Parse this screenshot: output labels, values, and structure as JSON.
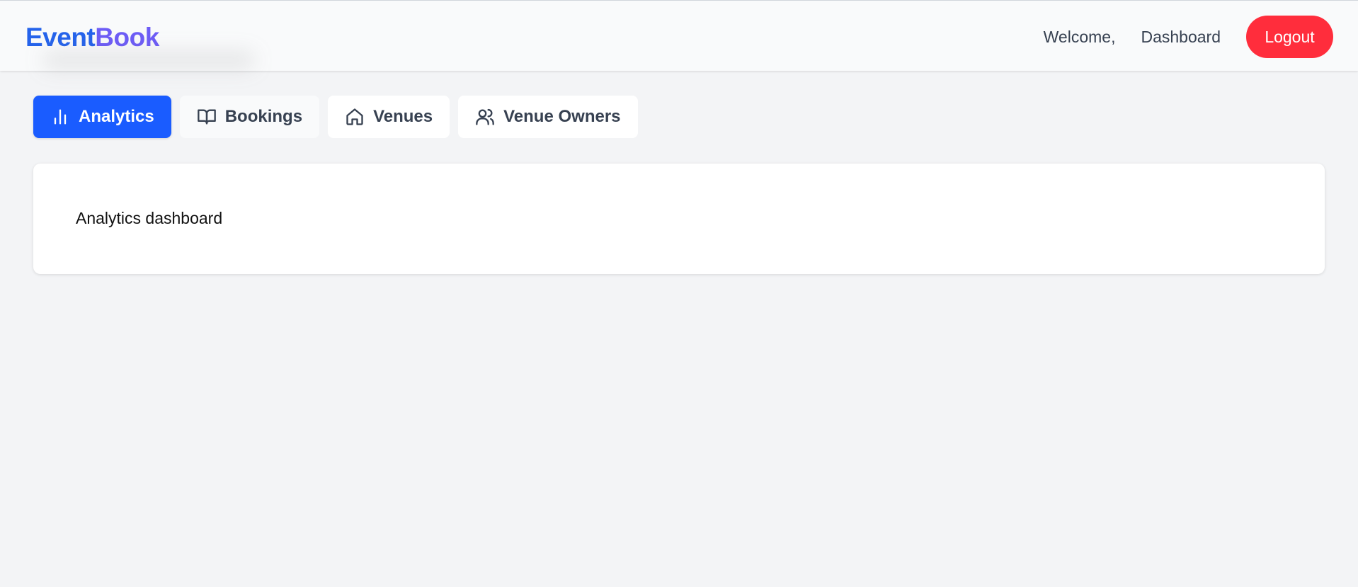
{
  "header": {
    "brand_part1": "Event",
    "brand_part2": "Book",
    "welcome_text": "Welcome,",
    "dashboard_link": "Dashboard",
    "logout_label": "Logout"
  },
  "tabs": [
    {
      "label": "Analytics",
      "icon": "bar-chart-icon",
      "active": true
    },
    {
      "label": "Bookings",
      "icon": "book-open-icon",
      "active": false
    },
    {
      "label": "Venues",
      "icon": "home-icon",
      "active": false
    },
    {
      "label": "Venue Owners",
      "icon": "users-icon",
      "active": false
    }
  ],
  "panel": {
    "text": "Analytics dashboard"
  },
  "colors": {
    "accent": "#1a5cff",
    "brand_primary": "#2563eb",
    "brand_secondary": "#6d5cf6",
    "logout": "#ff2d3c",
    "background": "#f3f4f6"
  }
}
